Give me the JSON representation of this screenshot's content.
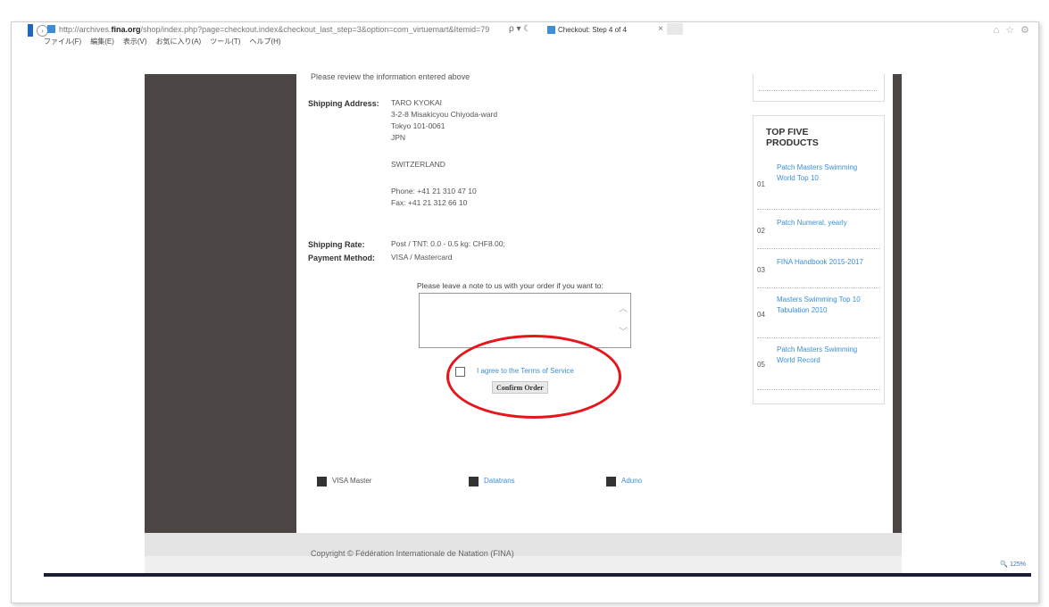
{
  "browser": {
    "url_prefix": "http://archives.",
    "url_domain": "fina.org",
    "url_rest": "/shop/index.php?page=checkout.index&checkout_last_step=3&option=com_virtuemart&Itemid=79",
    "url_actions": "ρ ▾ ☾",
    "tab_title": "Checkout: Step 4 of 4",
    "tab_close": "×",
    "toolbar_icons": "⌂ ☆ ⚙",
    "menu": [
      "ファイル(F)",
      "編集(E)",
      "表示(V)",
      "お気に入り(A)",
      "ツール(T)",
      "ヘルプ(H)"
    ],
    "zoom": "🔍 125%"
  },
  "checkout": {
    "truncated_heading": "Please review the information entered above",
    "shipping_address_label": "Shipping Address:",
    "address_lines": [
      "TARO KYOKAI",
      "3-2-8 Misakicyou Chiyoda-ward",
      "Tokyo 101-0061",
      "JPN"
    ],
    "country": "SWITZERLAND",
    "phone": "Phone: +41 21 310 47 10",
    "fax": "Fax: +41 21 312 66 10",
    "shipping_rate_label": "Shipping Rate:",
    "shipping_rate_value": "Post / TNT: 0.0 - 0.5 kg: CHF8.00;",
    "payment_method_label": "Payment Method:",
    "payment_method_value": "VISA / Mastercard",
    "note_label": "Please leave a note to us with your order if you want to:",
    "note_value": "",
    "tos_label": "I agree to the Terms of Service",
    "confirm_label": "Confirm Order"
  },
  "payments": [
    {
      "label": "VISA Master"
    },
    {
      "label": "Datatrans"
    },
    {
      "label": "Aduno"
    }
  ],
  "sidebar": {
    "top5_title": "TOP FIVE PRODUCTS",
    "items": [
      {
        "num": "01",
        "name": "Patch Masters Swimming World Top 10"
      },
      {
        "num": "02",
        "name": "Patch Numeral, yearly"
      },
      {
        "num": "03",
        "name": "FINA Handbook 2015-2017"
      },
      {
        "num": "04",
        "name": "Masters Swimming Top 10 Tabulation 2010"
      },
      {
        "num": "05",
        "name": "Patch Masters Swimming World Record"
      }
    ]
  },
  "footer": {
    "copyright": "Copyright © Fédération Internationale de Natation (FINA)"
  },
  "colors": {
    "highlight": "#e8141b",
    "link": "#3a8fd6",
    "dark_bar": "#4b4543"
  }
}
